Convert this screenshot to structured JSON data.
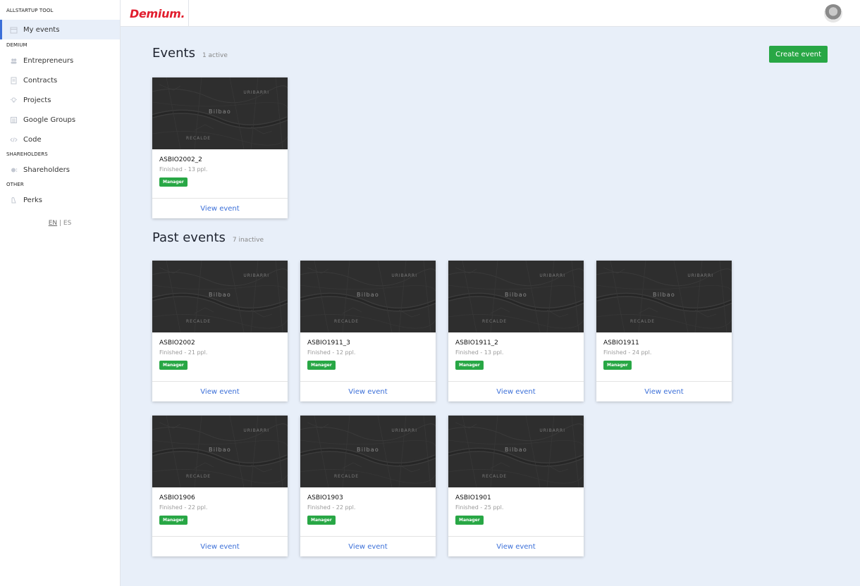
{
  "sidebar": {
    "sections": [
      {
        "label": "ALLSTARTUP TOOL",
        "items": [
          {
            "label": "My events",
            "icon": "calendar-icon",
            "active": true
          }
        ]
      },
      {
        "label": "DEMIUM",
        "items": [
          {
            "label": "Entrepreneurs",
            "icon": "users-icon"
          },
          {
            "label": "Contracts",
            "icon": "document-icon"
          },
          {
            "label": "Projects",
            "icon": "lightbulb-icon"
          },
          {
            "label": "Google Groups",
            "icon": "list-icon"
          },
          {
            "label": "Code",
            "icon": "code-icon"
          }
        ]
      },
      {
        "label": "SHAREHOLDERS",
        "items": [
          {
            "label": "Shareholders",
            "icon": "coins-icon"
          }
        ]
      },
      {
        "label": "OTHER",
        "items": [
          {
            "label": "Perks",
            "icon": "gift-icon"
          }
        ]
      }
    ],
    "lang": {
      "en": "EN",
      "sep": "|",
      "es": "ES"
    }
  },
  "header": {
    "logo": "Demium."
  },
  "events": {
    "title": "Events",
    "count": "1 active",
    "create_label": "Create event"
  },
  "past_events": {
    "title": "Past events",
    "count": "7 inactive"
  },
  "map_labels": {
    "top": "URIBARRI",
    "city": "Bilbao",
    "bottom": "RECALDE"
  },
  "active_cards": [
    {
      "name": "ASBIO2002_2",
      "status": "Finished - 13 ppl.",
      "badge": "Manager",
      "action": "View event"
    }
  ],
  "past_cards": [
    {
      "name": "ASBIO2002",
      "status": "Finished - 21 ppl.",
      "badge": "Manager",
      "action": "View event"
    },
    {
      "name": "ASBIO1911_3",
      "status": "Finished - 12 ppl.",
      "badge": "Manager",
      "action": "View event"
    },
    {
      "name": "ASBIO1911_2",
      "status": "Finished - 13 ppl.",
      "badge": "Manager",
      "action": "View event"
    },
    {
      "name": "ASBIO1911",
      "status": "Finished - 24 ppl.",
      "badge": "Manager",
      "action": "View event"
    },
    {
      "name": "ASBIO1906",
      "status": "Finished - 22 ppl.",
      "badge": "Manager",
      "action": "View event"
    },
    {
      "name": "ASBIO1903",
      "status": "Finished - 22 ppl.",
      "badge": "Manager",
      "action": "View event"
    },
    {
      "name": "ASBIO1901",
      "status": "Finished - 25 ppl.",
      "badge": "Manager",
      "action": "View event"
    }
  ],
  "colors": {
    "accent": "#3b6fd8",
    "success": "#28a745",
    "brand": "#e11d2e"
  }
}
